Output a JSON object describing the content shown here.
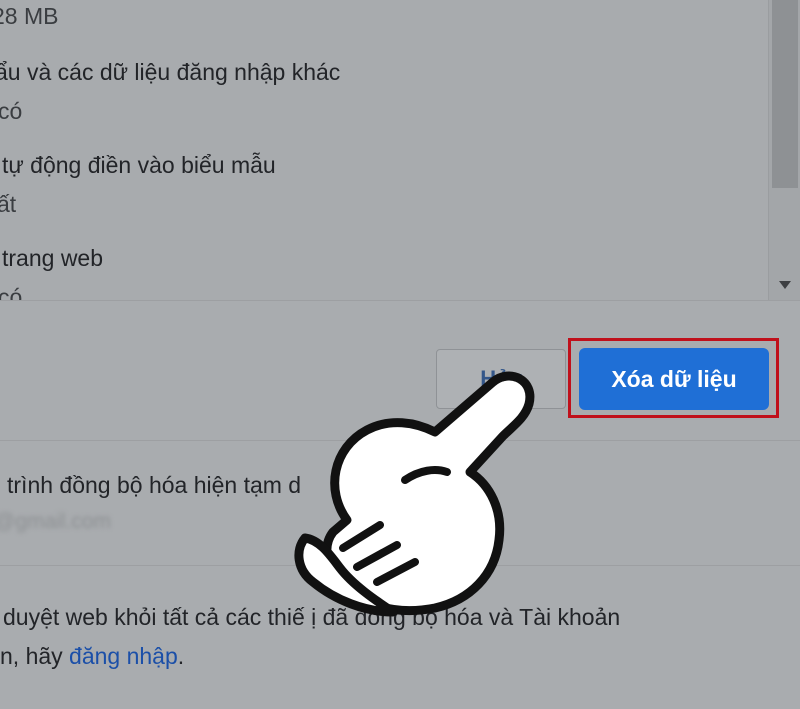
{
  "list": {
    "size_line": "28 MB",
    "item_passwords_title": "ẩu và các dữ liệu đăng nhập khác",
    "item_passwords_sub": "có",
    "item_autofill_title": "tự động điền vào biểu mẫu",
    "item_autofill_sub": "ất",
    "item_site_title": "trang web",
    "item_site_sub": "có"
  },
  "dialog": {
    "cancel_label": "Hủy",
    "clear_label": "Xóa dữ liệu",
    "highlight_color": "#c0101b",
    "primary_color": "#1f6fd6"
  },
  "sync": {
    "status_text": "trình đồng bộ hóa hiện tạm d",
    "account_email": "@gmail.com"
  },
  "footer": {
    "line1": "duyệt web khỏi tất cả các thiế  ị đã đồng bộ hóa và Tài khoản",
    "line2_prefix": "n, hãy ",
    "signin_link": "đăng nhập",
    "line2_suffix": "."
  },
  "overlay": {
    "pointer_icon": "pointing-hand-icon"
  }
}
